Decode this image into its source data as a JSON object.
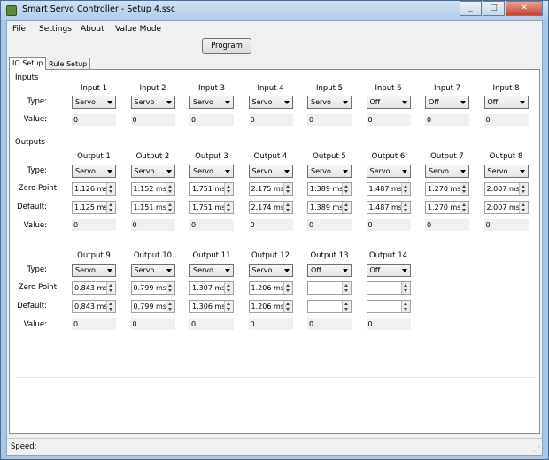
{
  "window": {
    "title": "Smart Servo Controller - Setup 4.ssc",
    "minimize_icon": "minimize-icon",
    "maximize_icon": "maximize-icon",
    "close_icon": "close-icon"
  },
  "menu": {
    "items": [
      "File",
      "Settings",
      "About",
      "Value Mode"
    ]
  },
  "toolbar": {
    "program_label": "Program"
  },
  "tabs": [
    "IO Setup",
    "Rule Setup"
  ],
  "inputs": {
    "section_title": "Inputs",
    "row_labels": {
      "type": "Type:",
      "value": "Value:"
    },
    "columns": [
      {
        "name": "Input 1",
        "type": "Servo",
        "value": "0"
      },
      {
        "name": "Input 2",
        "type": "Servo",
        "value": "0"
      },
      {
        "name": "Input 3",
        "type": "Servo",
        "value": "0"
      },
      {
        "name": "Input 4",
        "type": "Servo",
        "value": "0"
      },
      {
        "name": "Input 5",
        "type": "Servo",
        "value": "0"
      },
      {
        "name": "Input 6",
        "type": "Off",
        "value": "0"
      },
      {
        "name": "Input 7",
        "type": "Off",
        "value": "0"
      },
      {
        "name": "Input 8",
        "type": "Off",
        "value": "0"
      }
    ]
  },
  "outputs": {
    "section_title": "Outputs",
    "row_labels": {
      "type": "Type:",
      "zero": "Zero Point:",
      "default": "Default:",
      "value": "Value:"
    },
    "row1": [
      {
        "name": "Output 1",
        "type": "Servo",
        "zero": "1.126 ms",
        "default": "1.125 ms",
        "value": "0"
      },
      {
        "name": "Output 2",
        "type": "Servo",
        "zero": "1.152 ms",
        "default": "1.151 ms",
        "value": "0"
      },
      {
        "name": "Output 3",
        "type": "Servo",
        "zero": "1.751 ms",
        "default": "1.751 ms",
        "value": "0"
      },
      {
        "name": "Output 4",
        "type": "Servo",
        "zero": "2.175 ms",
        "default": "2.174 ms",
        "value": "0"
      },
      {
        "name": "Output 5",
        "type": "Servo",
        "zero": "1.389 ms",
        "default": "1.389 ms",
        "value": "0"
      },
      {
        "name": "Output 6",
        "type": "Servo",
        "zero": "1.487 ms",
        "default": "1.487 ms",
        "value": "0"
      },
      {
        "name": "Output 7",
        "type": "Servo",
        "zero": "1.270 ms",
        "default": "1.270 ms",
        "value": "0"
      },
      {
        "name": "Output 8",
        "type": "Servo",
        "zero": "2.007 ms",
        "default": "2.007 ms",
        "value": "0"
      }
    ],
    "row2": [
      {
        "name": "Output 9",
        "type": "Servo",
        "zero": "0.843 ms",
        "default": "0.843 ms",
        "value": "0"
      },
      {
        "name": "Output 10",
        "type": "Servo",
        "zero": "0.799 ms",
        "default": "0.799 ms",
        "value": "0"
      },
      {
        "name": "Output 11",
        "type": "Servo",
        "zero": "1.307 ms",
        "default": "1.306 ms",
        "value": "0"
      },
      {
        "name": "Output 12",
        "type": "Servo",
        "zero": "1.206 ms",
        "default": "1.206 ms",
        "value": "0"
      },
      {
        "name": "Output 13",
        "type": "Off",
        "zero": "",
        "default": "",
        "value": "0"
      },
      {
        "name": "Output 14",
        "type": "Off",
        "zero": "",
        "default": "",
        "value": "0"
      }
    ]
  },
  "status": {
    "speed_label": "Speed:"
  }
}
